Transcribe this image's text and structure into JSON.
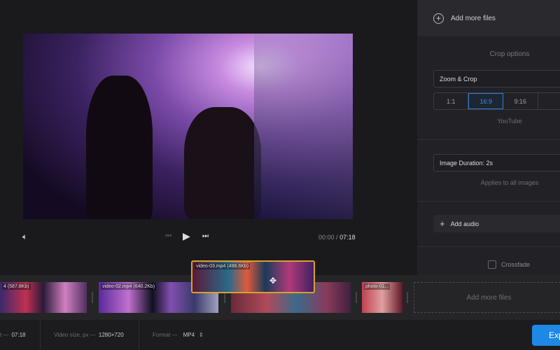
{
  "player": {
    "time_current": "00:00",
    "time_sep": "/",
    "time_total": "07:18"
  },
  "right_panel": {
    "add_files_label": "Add more files",
    "crop_title": "Crop options",
    "crop_mode": "Zoom & Crop",
    "ratios": [
      {
        "label": "1:1",
        "selected": false
      },
      {
        "label": "16:9",
        "selected": true
      },
      {
        "label": "9:16",
        "selected": false
      }
    ],
    "ratio_caption": "YouTube",
    "image_duration": "Image Duration: 2s",
    "duration_caption": "Applies to all images",
    "add_audio": "Add audio",
    "crossfade_label": "Crossfade",
    "crossfade_checked": false
  },
  "timeline": {
    "clips": [
      {
        "label": "4 (587.8Kb)"
      },
      {
        "label": "video-02.mp4 (640.2Kb)"
      },
      {
        "label": ""
      },
      {
        "label": "photo-01..."
      }
    ],
    "dragged_clip": "video-03.mp4 (498.6Kb)",
    "drop_label": "Add more files"
  },
  "bottom": {
    "duration_label": "t —",
    "duration_value": "07:18",
    "size_label": "Video size, px —",
    "size_value": "1280×720",
    "format_label": "Format —",
    "format_value": "MP4",
    "export_label": "Exp"
  },
  "colors": {
    "accent": "#1e88e5",
    "drag_border": "#d6a32a",
    "selected_ratio": "#3b8fe8"
  }
}
